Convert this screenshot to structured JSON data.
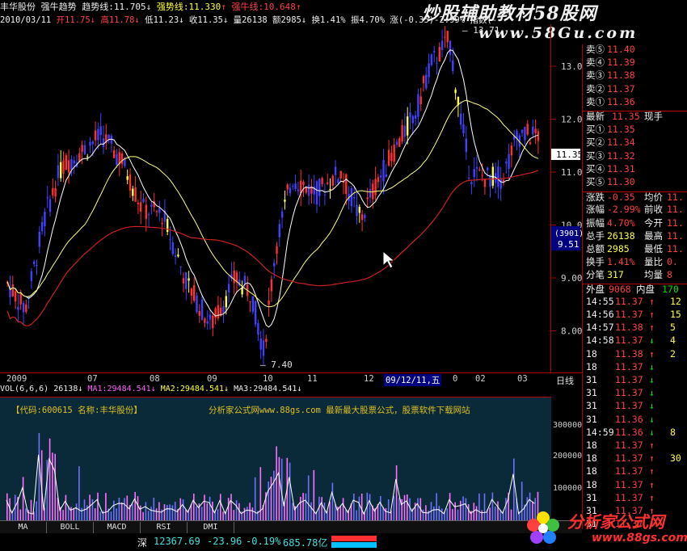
{
  "header": {
    "stock_name": "丰华股份",
    "indicator_name": "强牛趋势",
    "trend_label": "趋势线:",
    "trend_value": "11.705",
    "strong_trend_label": "强势线:",
    "strong_trend_value": "11.330",
    "bull_label": "强牛线:",
    "bull_value": "10.648"
  },
  "info": {
    "date": "2010/03/11",
    "open_label": "开",
    "open": "11.75",
    "high_label": "高",
    "high": "11.78",
    "low_label": "低",
    "low": "11.23",
    "close_label": "收",
    "close": "11.35",
    "volume_label": "量",
    "volume": "26138",
    "amount_label": "额",
    "amount": "2985",
    "turnover_label": "换",
    "turnover": "1.41%",
    "amplitude_label": "振",
    "amplitude": "4.70%",
    "change_label": "涨",
    "change": "(-0.35)-2.99%",
    "index_label": "指数(-"
  },
  "watermark": {
    "line1": "炒股辅助教材58股网",
    "line2": "www.58Gu.com"
  },
  "chart_data": {
    "type": "candlestick",
    "price_axis": [
      "13.00",
      "12.00",
      "11.00",
      "10.00",
      "9.00",
      "8.00"
    ],
    "ylim": [
      7.2,
      13.8
    ],
    "max_label": "13.71",
    "min_label": "7.40",
    "current_price_label": "11.35",
    "cursor_label": "(3901)",
    "cursor_price": "9.51",
    "date_ticks": [
      "2009",
      "07",
      "08",
      "09",
      "10",
      "11",
      "12",
      "09/12/11,五",
      "0",
      "02",
      "03"
    ],
    "period_label": "日线",
    "colors": {
      "up": "#ff3030",
      "down": "#4040ff",
      "ma_short": "#ffffff",
      "ma_mid": "#ffff80",
      "ma_long": "#d02020",
      "highlight": "#ffff40"
    }
  },
  "volume": {
    "head_label": "VOL(6,6,6)",
    "value": "26138",
    "ma1": "MA1:29484.541",
    "ma2": "MA2:29484.541",
    "ma3": "MA3:29484.541",
    "code_label": "【代码:600615 名称:丰华股份】",
    "ad_text": "分析家公式网www.88gs.com 最新最大股票公式，股票软件下载网站",
    "axis": [
      "300000",
      "200000",
      "100000"
    ]
  },
  "order_book": {
    "asks": [
      {
        "label": "卖⑤",
        "price": "11.40"
      },
      {
        "label": "卖④",
        "price": "11.39"
      },
      {
        "label": "卖③",
        "price": "11.38"
      },
      {
        "label": "卖②",
        "price": "11.37"
      },
      {
        "label": "卖①",
        "price": "11.36"
      }
    ],
    "latest_label": "最新",
    "latest_price": "11.35",
    "hand_label": "现手",
    "bids": [
      {
        "label": "买①",
        "price": "11.35"
      },
      {
        "label": "买②",
        "price": "11.34"
      },
      {
        "label": "买③",
        "price": "11.32"
      },
      {
        "label": "买④",
        "price": "11.31"
      },
      {
        "label": "买⑤",
        "price": "11.30"
      }
    ]
  },
  "stats": [
    {
      "l1": "涨跌",
      "v1": "-0.35",
      "l2": "均价",
      "v2": "11."
    },
    {
      "l1": "涨幅",
      "v1": "-2.99%",
      "l2": "前收",
      "v2": "11."
    },
    {
      "l1": "振幅",
      "v1": "4.70%",
      "l2": "今开",
      "v2": "11."
    },
    {
      "l1": "总手",
      "v1": "26138",
      "l2": "最高",
      "v2": "11."
    },
    {
      "l1": "总额",
      "v1": "2985",
      "l2": "最低",
      "v2": "11."
    },
    {
      "l1": "换手",
      "v1": "1.41%",
      "l2": "量比",
      "v2": "0."
    },
    {
      "l1": "分笔",
      "v1": "317",
      "l2": "均量",
      "v2": "8"
    }
  ],
  "outer_inner": {
    "outer_label": "外盘",
    "outer": "9068",
    "inner_label": "内盘",
    "inner": "170"
  },
  "ticks": [
    {
      "time": "14:55",
      "price": "11.37",
      "arrow": "↑",
      "vol": "12"
    },
    {
      "time": "14:56",
      "price": "11.37",
      "arrow": "↑",
      "vol": "15"
    },
    {
      "time": "14:57",
      "price": "11.38",
      "arrow": "↑",
      "vol": "5"
    },
    {
      "time": "14:58",
      "price": "11.37",
      "arrow": "↓",
      "vol": "4"
    },
    {
      "time": "18",
      "price": "11.38",
      "arrow": "↑",
      "vol": "2"
    },
    {
      "time": "18",
      "price": "11.37",
      "arrow": "↓",
      "vol": ""
    },
    {
      "time": "31",
      "price": "11.37",
      "arrow": "↓",
      "vol": ""
    },
    {
      "time": "31",
      "price": "11.37",
      "arrow": "↓",
      "vol": ""
    },
    {
      "time": "31",
      "price": "11.37",
      "arrow": "↓",
      "vol": ""
    },
    {
      "time": "31",
      "price": "11.36",
      "arrow": "↓",
      "vol": ""
    },
    {
      "time": "14:59",
      "price": "11.36",
      "arrow": "↓",
      "vol": "8"
    },
    {
      "time": "18",
      "price": "11.37",
      "arrow": "↑",
      "vol": ""
    },
    {
      "time": "18",
      "price": "11.37",
      "arrow": "↑",
      "vol": "30"
    },
    {
      "time": "18",
      "price": "11.37",
      "arrow": "↑",
      "vol": ""
    },
    {
      "time": "18",
      "price": "11.37",
      "arrow": "↑",
      "vol": ""
    },
    {
      "time": "31",
      "price": "11.37",
      "arrow": "↑",
      "vol": ""
    },
    {
      "time": "31",
      "price": "11.37",
      "arrow": "↑",
      "vol": ""
    },
    {
      "time": "31",
      "price": "11.37",
      "arrow": "↑",
      "vol": ""
    }
  ],
  "tabs": [
    "MA",
    "BOLL",
    "MACD",
    "RSI",
    "DMI"
  ],
  "status": {
    "market": "深",
    "index": "12367.69",
    "change": "-23.96",
    "pct": "-0.19%",
    "amount": "685.78亿"
  },
  "logo": {
    "title": "分析家公式网",
    "url": "www.88gs.com"
  }
}
